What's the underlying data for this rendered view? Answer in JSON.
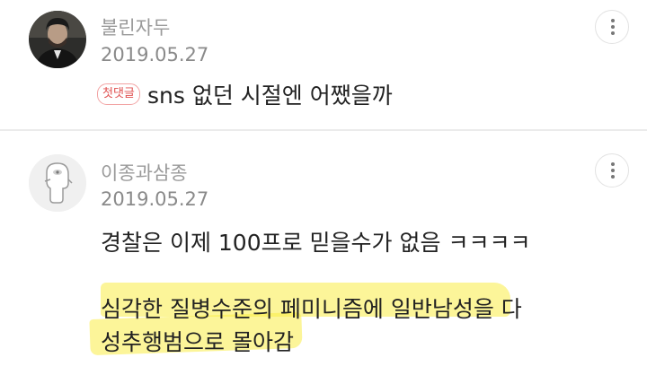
{
  "comments": [
    {
      "username": "불린자두",
      "date": "2019.05.27",
      "badge": "첫댓글",
      "text": "sns 없던 시절엔 어쨌을까",
      "avatar_icon": "man-in-suit-avatar"
    },
    {
      "username": "이종과삼종",
      "date": "2019.05.27",
      "lines": [
        "경찰은 이제 100프로 믿을수가 없음 ㅋㅋㅋㅋ",
        "심각한 질병수준의 페미니즘에 일반남성을 다",
        "성추행범으로 몰아감"
      ],
      "avatar_icon": "default-character-avatar"
    }
  ],
  "colors": {
    "username": "#9a9a9a",
    "date": "#8a8a8a",
    "badge": "#e05050",
    "highlight": "#faec46",
    "divider": "#ebebeb"
  },
  "icons": {
    "more": "vertical-ellipsis-icon"
  }
}
